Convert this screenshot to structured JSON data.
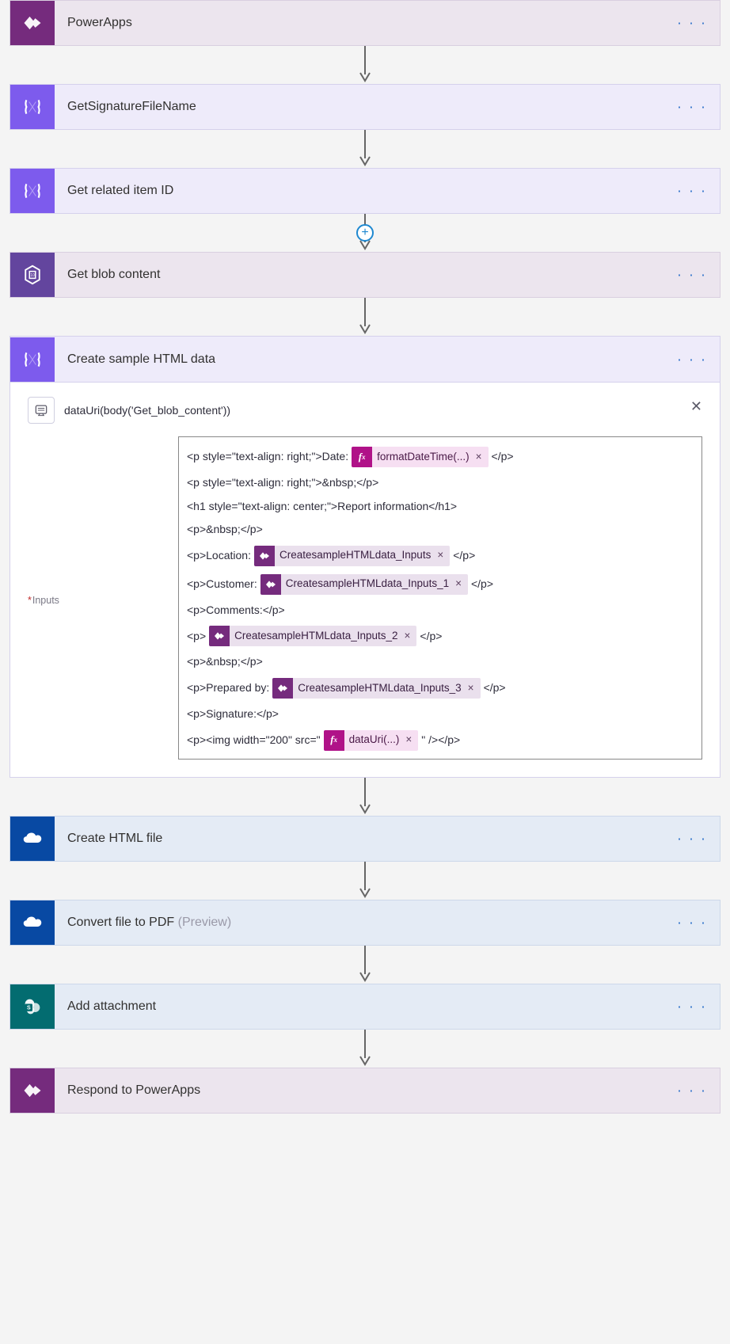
{
  "steps": {
    "powerapps": {
      "title": "PowerApps"
    },
    "getSig": {
      "title": "GetSignatureFileName"
    },
    "getId": {
      "title": "Get related item ID"
    },
    "getBlob": {
      "title": "Get blob content"
    },
    "createHtml": {
      "title": "Create sample HTML data"
    },
    "createFile": {
      "title": "Create HTML file"
    },
    "convertPdf": {
      "title": "Convert file to PDF ",
      "preview": "(Preview)"
    },
    "addAttach": {
      "title": "Add attachment"
    },
    "respond": {
      "title": "Respond to PowerApps"
    }
  },
  "expanded": {
    "formula": "dataUri(body('Get_blob_content'))",
    "inputsLabel": "Inputs",
    "lines": {
      "l1a": "<p style=\"text-align: right;\">Date: ",
      "l1token": "formatDateTime(...)",
      "l1b": " </p>",
      "l2": "<p style=\"text-align: right;\">&nbsp;</p>",
      "l3": "<h1 style=\"text-align: center;\">Report information</h1>",
      "l4": "<p>&nbsp;</p>",
      "l5a": "<p>Location: ",
      "l5token": "CreatesampleHTMLdata_Inputs",
      "l5b": " </p>",
      "l6a": "<p>Customer: ",
      "l6token": "CreatesampleHTMLdata_Inputs_1",
      "l6b": " </p>",
      "l7": "<p>Comments:</p>",
      "l8a": "<p> ",
      "l8token": "CreatesampleHTMLdata_Inputs_2",
      "l8b": " </p>",
      "l9": "<p>&nbsp;</p>",
      "l10a": "<p>Prepared by: ",
      "l10token": "CreatesampleHTMLdata_Inputs_3",
      "l10b": " </p>",
      "l11": "<p>Signature:</p>",
      "l12a": "<p><img width=\"200\" src=\"",
      "l12token": "dataUri(...)",
      "l12b": "\" /></p>"
    }
  }
}
